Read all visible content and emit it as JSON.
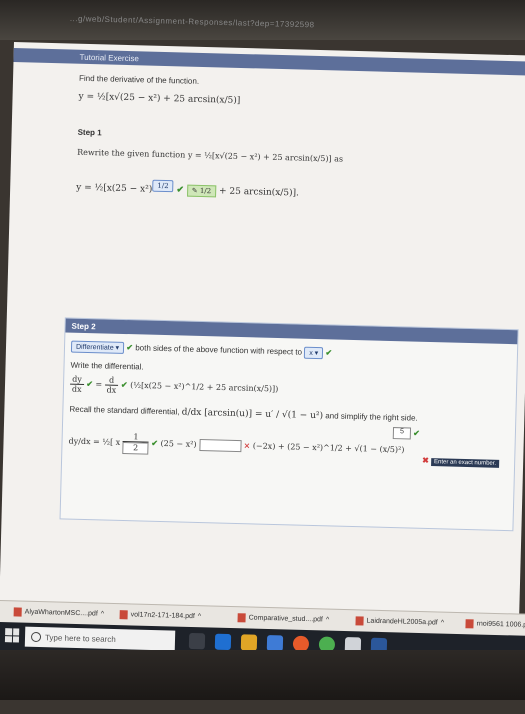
{
  "browser": {
    "url_fragment": "...g/web/Student/Assignment-Responses/last?dep=17392598"
  },
  "tutorial": {
    "header": "Tutorial Exercise",
    "prompt": "Find the derivative of the function.",
    "function": "y = ½[x√(25 − x²) + 25 arcsin(x/5)]"
  },
  "step1": {
    "label": "Step 1",
    "instruction": "Rewrite the given function  y = ½[x√(25 − x²) + 25 arcsin(x/5)]  as",
    "rewritten_prefix": "y = ½[x(25 − x²)",
    "exponent_answer": "1/2",
    "inserted_value": "1/2",
    "rewritten_suffix": "+ 25 arcsin(x/5)]."
  },
  "step2": {
    "label": "Step 2",
    "select_value": "Differentiate",
    "text1": "both sides of the above function with respect to",
    "wrt_value": "x",
    "write_label": "Write the differential.",
    "lhs": "dy",
    "lhs_den": "dx",
    "rhs_num": "d",
    "rhs_den": "dx",
    "rhs_expr": "(½[x(25 − x²)^1/2 + 25 arcsin(x/5)])",
    "recall_text": "Recall the standard differential,",
    "recall_formula": "d/dx [arcsin(u)] = u′ / √(1 − u²)",
    "recall_tail": "and simplify the right side.",
    "deriv_lhs": "dy/dx = ½[",
    "box_x": "x",
    "box_num": "1",
    "box_den": "2",
    "mid_expr": "(25 − x²)",
    "wrong_mark": "×",
    "tail_expr": "(−2x) + (25 − x²)^1/2 +",
    "sqrt_part": "√(1 − (x/5)²)",
    "tiny_five": "5",
    "hint": "Enter an exact number."
  },
  "downloads": [
    {
      "name": "AlyaWhartonMSC....pdf"
    },
    {
      "name": "vol17n2-171-184.pdf"
    },
    {
      "name": "Comparative_stud....pdf"
    },
    {
      "name": "LaidrandeHL2005a.pdf"
    },
    {
      "name": "rnoi9561 1006.pdf"
    }
  ],
  "taskbar": {
    "search_placeholder": "Type here to search"
  }
}
